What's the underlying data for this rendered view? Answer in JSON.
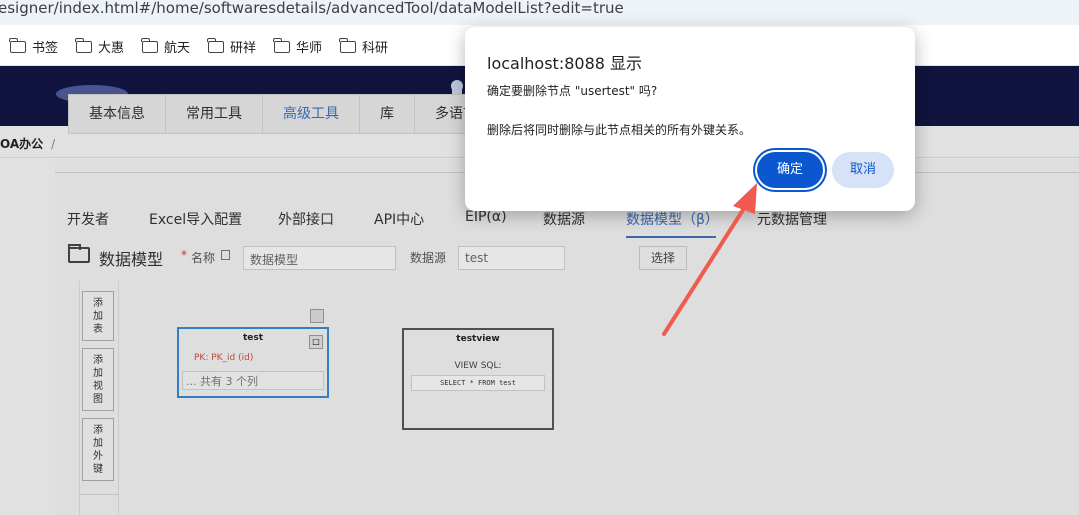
{
  "browser": {
    "url": "esigner/index.html#/home/softwaresdetails/advancedTool/dataModelList?edit=true",
    "bookmarks": [
      "书签",
      "大惠",
      "航天",
      "研祥",
      "华师",
      "科研"
    ]
  },
  "breadcrumb": {
    "current": "OA办公",
    "separator": "/"
  },
  "main_tabs": [
    "基本信息",
    "常用工具",
    "高级工具",
    "库",
    "多语言"
  ],
  "sub_tabs": [
    "开发者",
    "Excel导入配置",
    "外部接口",
    "API中心",
    "EIP(α)",
    "数据源",
    "数据模型（β）",
    "元数据管理"
  ],
  "form": {
    "title": "数据模型",
    "required_mark": "*",
    "name_label": "名称",
    "name_value": "数据模型",
    "datasource_label": "数据源",
    "datasource_value": "test",
    "select_button": "选择"
  },
  "toolbox": [
    "添加表",
    "添加视图",
    "添加外键"
  ],
  "nodes": {
    "table": {
      "title": "test",
      "pk": "PK: PK_id (id)",
      "columns": "... 共有 3 个列",
      "delete_icon": "□"
    },
    "view": {
      "title": "testview",
      "sql_label": "VIEW SQL:",
      "sql": "SELECT * FROM test"
    }
  },
  "dialog": {
    "title": "localhost:8088 显示",
    "message": "确定要删除节点 \"usertest\" 吗?",
    "detail": "删除后将同时删除与此节点相关的所有外键关系。",
    "ok": "确定",
    "cancel": "取消"
  },
  "colors": {
    "accent": "#0b57d0",
    "annotation_arrow": "#f05a4f",
    "banner": "#121642"
  }
}
